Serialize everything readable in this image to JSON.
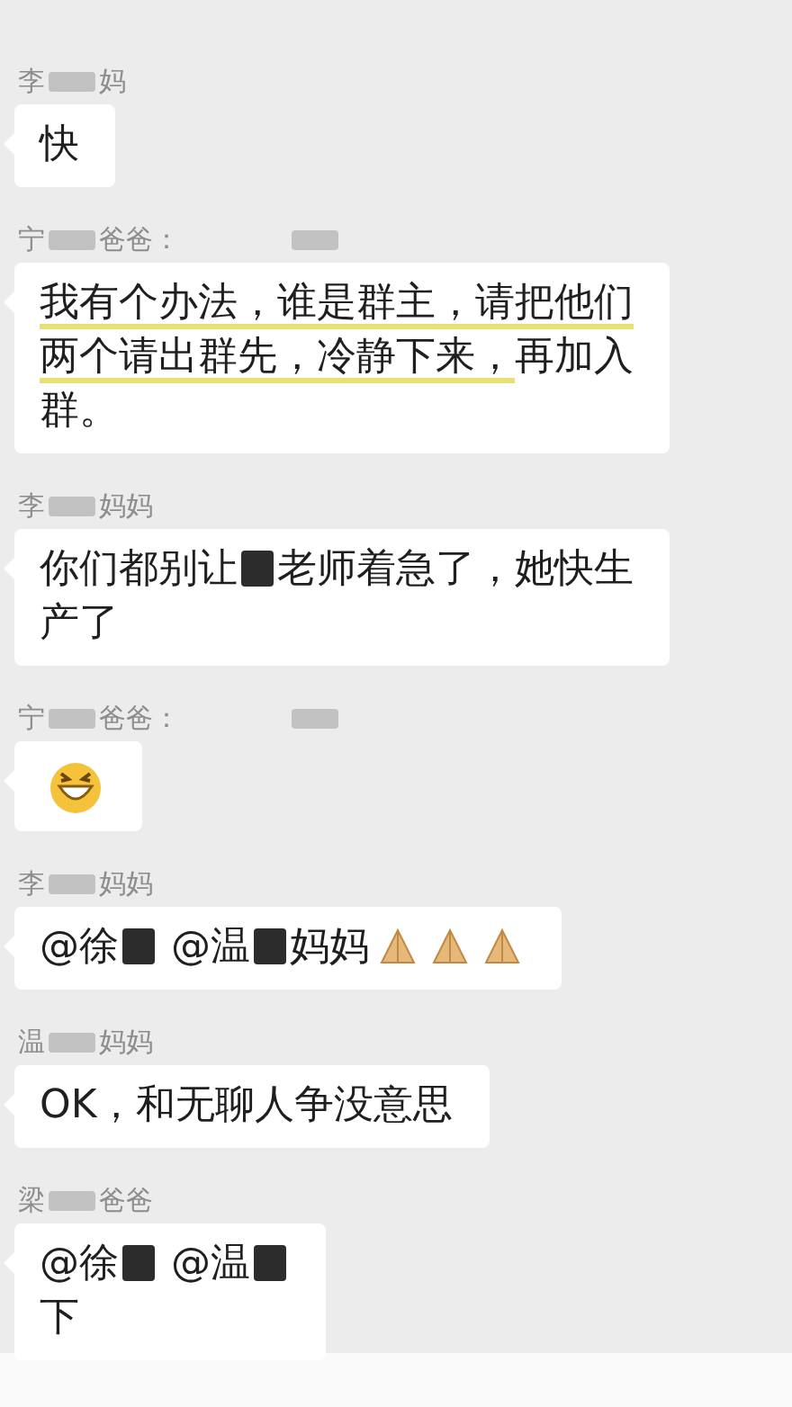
{
  "messages": [
    {
      "sender": [
        {
          "kind": "text",
          "text": "李"
        },
        {
          "kind": "blur"
        },
        {
          "kind": "text",
          "text": "妈"
        }
      ],
      "content": [
        {
          "kind": "text",
          "text": "快"
        }
      ]
    },
    {
      "sender": [
        {
          "kind": "text",
          "text": "宁"
        },
        {
          "kind": "blur"
        },
        {
          "kind": "text",
          "text": "爸爸："
        },
        {
          "kind": "gap"
        },
        {
          "kind": "blur"
        }
      ],
      "content": [
        {
          "kind": "text",
          "text": "我有个办法，谁是群主，请把他们",
          "underlined": true
        },
        {
          "kind": "break"
        },
        {
          "kind": "text",
          "text": "两个请出群先，冷静下来，",
          "underlined": true
        },
        {
          "kind": "text",
          "text": "再加入",
          "underlined": false
        },
        {
          "kind": "break"
        },
        {
          "kind": "text",
          "text": "群。",
          "underlined": false
        }
      ]
    },
    {
      "sender": [
        {
          "kind": "text",
          "text": "李"
        },
        {
          "kind": "blur"
        },
        {
          "kind": "text",
          "text": "妈妈"
        }
      ],
      "content": [
        {
          "kind": "text",
          "text": "你们都别让"
        },
        {
          "kind": "redaction"
        },
        {
          "kind": "text",
          "text": "老师着急了，她快生"
        },
        {
          "kind": "break"
        },
        {
          "kind": "text",
          "text": "产了"
        }
      ]
    },
    {
      "sender": [
        {
          "kind": "text",
          "text": "宁"
        },
        {
          "kind": "blur"
        },
        {
          "kind": "text",
          "text": "爸爸："
        },
        {
          "kind": "gap"
        },
        {
          "kind": "blur"
        }
      ],
      "content": [
        {
          "kind": "grin"
        }
      ]
    },
    {
      "sender": [
        {
          "kind": "text",
          "text": "李"
        },
        {
          "kind": "blur"
        },
        {
          "kind": "text",
          "text": "妈妈"
        }
      ],
      "content": [
        {
          "kind": "text",
          "text": "@徐"
        },
        {
          "kind": "redaction"
        },
        {
          "kind": "text",
          "text": " @温"
        },
        {
          "kind": "redaction"
        },
        {
          "kind": "text",
          "text": "妈妈"
        },
        {
          "kind": "pray"
        },
        {
          "kind": "pray"
        },
        {
          "kind": "pray"
        }
      ]
    },
    {
      "sender": [
        {
          "kind": "text",
          "text": "温"
        },
        {
          "kind": "blur"
        },
        {
          "kind": "text",
          "text": "妈妈"
        }
      ],
      "content": [
        {
          "kind": "text",
          "text": "OK，和无聊人争没意思"
        }
      ]
    },
    {
      "sender": [
        {
          "kind": "text",
          "text": "梁"
        },
        {
          "kind": "blur"
        },
        {
          "kind": "text",
          "text": "爸爸"
        }
      ],
      "content": [
        {
          "kind": "text",
          "text": "@徐"
        },
        {
          "kind": "redaction"
        },
        {
          "kind": "text",
          "text": " @温"
        },
        {
          "kind": "redaction"
        },
        {
          "kind": "break"
        },
        {
          "kind": "text",
          "text": "下"
        }
      ]
    }
  ]
}
